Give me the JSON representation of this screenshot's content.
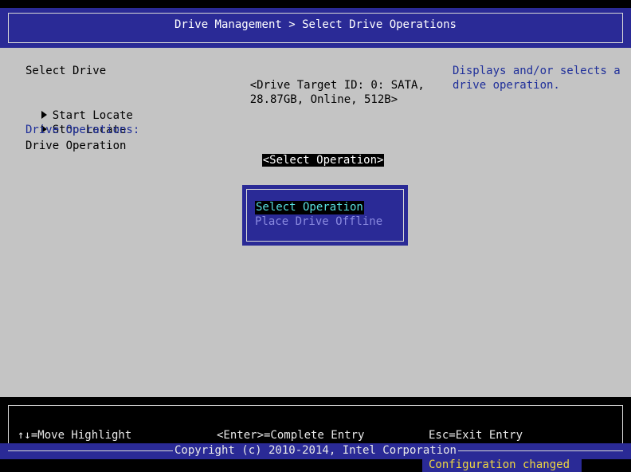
{
  "header": {
    "title": "Drive Management > Select Drive Operations"
  },
  "form": {
    "select_drive_label": "Select Drive",
    "drive_value_line1": "<Drive Target ID: 0: SATA,",
    "drive_value_line2": "28.87GB, Online, 512B>",
    "start_locate": "Start Locate",
    "stop_locate": "Stop Locate",
    "drive_operations_heading": "Drive Operations:",
    "drive_operation_label": "Drive Operation",
    "drive_operation_value": "<Select Operation>"
  },
  "help": {
    "line1": "Displays and/or selects a",
    "line2": "drive operation."
  },
  "popup": {
    "options": [
      "Select Operation",
      "Place Drive Offline"
    ],
    "selected_index": 0
  },
  "footer": {
    "move_highlight": "↑↓=Move Highlight",
    "complete_entry": "<Enter>=Complete Entry",
    "exit_entry": "Esc=Exit Entry",
    "copyright": "Copyright (c) 2010-2014, Intel Corporation",
    "status": "Configuration changed"
  },
  "colors": {
    "header_bg": "#2a2a96",
    "panel_bg": "#c4c4c4",
    "help_text": "#1f2f9a",
    "highlight_text": "#58e0e0",
    "status_text": "#f0d840"
  }
}
